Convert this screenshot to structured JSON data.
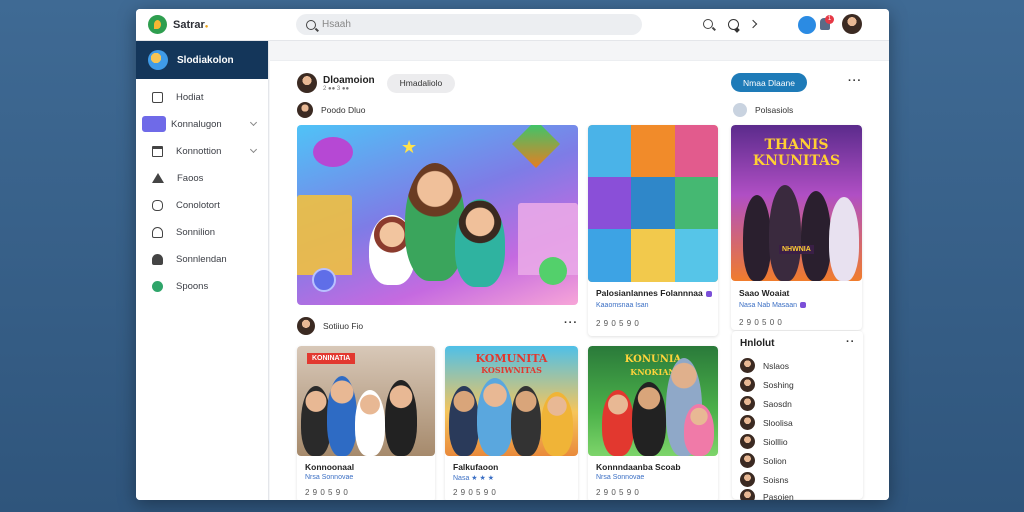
{
  "app": {
    "title": "Satrar",
    "title_accent": "●",
    "accent": "#1e7bb8",
    "sidebar_head_color": "#14365a"
  },
  "search": {
    "placeholder": "Hsaah"
  },
  "topbar": {
    "notif_count": "1"
  },
  "sidebar": {
    "header": "Slodiakolon",
    "items": [
      {
        "label": "Hodiat",
        "icon": "home-icon"
      },
      {
        "label": "Konnalugon",
        "icon": "star-icon",
        "chevron": true,
        "active": true
      },
      {
        "label": "Konnottion",
        "icon": "calendar-icon",
        "chevron": true
      },
      {
        "label": "Faoos",
        "icon": "triangle-icon"
      },
      {
        "label": "Conolotort",
        "icon": "hexagon-icon"
      },
      {
        "label": "Sonnilion",
        "icon": "user-icon"
      },
      {
        "label": "Sonnlendan",
        "icon": "bell-icon"
      },
      {
        "label": "Spoons",
        "icon": "green-circle-icon"
      }
    ]
  },
  "profile": {
    "name": "Dloamoion",
    "sub": "2 ●● 3 ●●",
    "pill": "Hmadaliolo",
    "join": "Nmaa Dlaane",
    "sub_user": "Poodo Dluo",
    "side_user": "Polsasiols"
  },
  "feature_post": {
    "author": "Sotiiuo Fio"
  },
  "cards_right": [
    {
      "caption": "Palosianlannes Folannnaa",
      "meta": "Kaaomsnaa Isan",
      "nums": "2 9 0  5 9 0"
    },
    {
      "caption": "Saao Woaiat",
      "meta": "Nasa Nab Masaan",
      "nums": "2 9 0  5 0 0",
      "banner": "THANIS KNUNITAS",
      "banner_small": "NHWNIA"
    }
  ],
  "cards_bottom": [
    {
      "caption": "Konnoonaal",
      "meta": "Nrsa Sonnovae",
      "nums": "2 9 0  5 9 0",
      "banner": "KONINATIA"
    },
    {
      "caption": "Falkufaoon",
      "meta": "Nasa ★ ★ ★",
      "nums": "2 9 0  5 9 0",
      "banner": "KOMUNITA",
      "banner2": "KOSIWNITAS"
    },
    {
      "caption": "Konnndaanba Scoab",
      "meta": "Nrsa Sonnovae",
      "nums": "2 9 0  5 9 0",
      "banner": "KONUNIA",
      "banner2": "KNOKIAN"
    }
  ],
  "friends": {
    "title": "Hnlolut",
    "items": [
      "Nslaos",
      "Soshing",
      "Saosdn",
      "Sloolisa",
      "Siolllio",
      "Solion",
      "Soisns",
      "Pasoien"
    ]
  }
}
